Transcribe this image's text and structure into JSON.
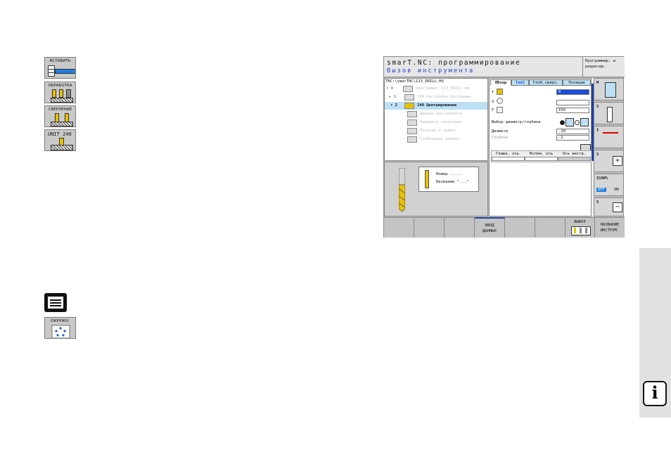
{
  "manual_icons": [
    {
      "label": "ВСТАВИТЬ"
    },
    {
      "label": "ОБРАБОТКА"
    },
    {
      "label": "СВЕРЛЕНИЕ"
    },
    {
      "label": "UNIT 240"
    }
  ],
  "lower_icons": [
    {
      "label": ""
    },
    {
      "label": "ОКРУЖН."
    }
  ],
  "screen": {
    "title": "smarT.NC: программирование",
    "subtitle": "Вызов инструмента",
    "mode_label": "Программир. и редактир.",
    "path": "TNC:\\smarTNC\\123_DRILL.HU",
    "tree": [
      {
        "marker": "▾ 0",
        "text": "Программа: 123_DRILL мм"
      },
      {
        "marker": "▸ 1",
        "text": "700 Настройки программы"
      },
      {
        "marker": "▾ 2",
        "text": "240 Центрирование"
      },
      {
        "marker": "",
        "text": "Данные инструмента"
      },
      {
        "marker": "",
        "text": "Параметр сверления"
      },
      {
        "marker": "",
        "text": "Позиции и зажим"
      },
      {
        "marker": "",
        "text": "Глобальные данные"
      }
    ],
    "info_box": {
      "row1": "Номер   .....",
      "row2": "Название \"...\""
    },
    "tabs": [
      "Обзор",
      "Tool",
      "Глоб.сверл.",
      "Позиции"
    ],
    "fields": [
      {
        "key": "T",
        "value": "0"
      },
      {
        "key": "S",
        "value": ""
      },
      {
        "key": "F",
        "value": "150"
      }
    ],
    "depth_select_label": "Выбор диаметр/глубина",
    "diameter_label": "Диаметр",
    "diameter_value": "-10",
    "depth_label": "Глубина",
    "depth_value": "-2",
    "axis_headers": [
      "Главн. ось",
      "Вспом. ось",
      "Ось инстр."
    ],
    "softkeys": [
      "",
      "",
      "",
      "ВВОД ДАННЫХ",
      "",
      "",
      "ВЫБОР",
      "НАЗВАНИЕ ИНСТРУМ."
    ],
    "side_labels": [
      "M",
      "S",
      "T",
      "S",
      "S100%",
      "S"
    ],
    "side_off": "OFF",
    "side_on": "ON"
  },
  "info_glyph": "i"
}
